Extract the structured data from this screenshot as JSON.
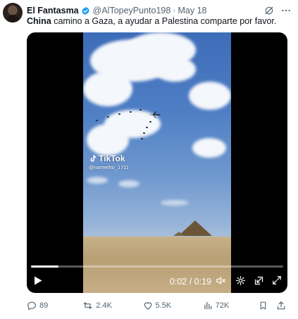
{
  "tweet": {
    "author_name": "El Fantasma",
    "handle": "@AlTopeyPunto198",
    "separator": "·",
    "date": "May 18",
    "text_bold": "China",
    "text_rest": " camino a Gaza, a ayudar a Palestina comparte por favor."
  },
  "video": {
    "watermark_brand": "TikTok",
    "watermark_user": "@nametho_1711",
    "time_display": "0:02 / 0:19",
    "progress_fraction": 0.11
  },
  "actions": {
    "replies": "89",
    "reposts": "2.4K",
    "likes": "5.5K",
    "views": "72K"
  },
  "colors": {
    "verified": "#1d9bf0",
    "secondary_text": "#536471"
  }
}
